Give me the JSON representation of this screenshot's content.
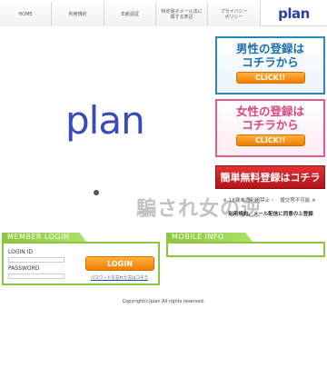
{
  "nav": {
    "items": [
      "HOME",
      "利用規約",
      "年齢認証",
      "特定電子メール法に\n関する表記",
      "プライバシー\nポリシー"
    ],
    "logo": "plan"
  },
  "hero": {
    "logo": "plan"
  },
  "banners": {
    "male_title": "男性の登録は\nコチラから",
    "male_button": "CLICK!!",
    "female_title": "女性の登録は\nコチラから",
    "female_button": "CLICK!!",
    "free_register": "簡単無料登録はコチラ",
    "age_note": "※ 18歳未満利用禁止・　援交等不可能 ※",
    "watermark": "騙され女の逆",
    "terms_note": "利用規約、メール配信に同意の上登録"
  },
  "login": {
    "heading": "MEMBER LOGIN",
    "id_label": "LOGIN ID",
    "password_label": "PASSWORD",
    "id_value": "",
    "password_value": "",
    "button": "LOGIN",
    "forgot": "パスワードを忘れた方はコチラ"
  },
  "mobile": {
    "heading": "MOBILE INFO"
  },
  "footer": {
    "copyright": "Copyright(c)plan All rights reserved."
  },
  "colors": {
    "accent_green": "#8cc63f",
    "brand_blue": "#3a4bb8",
    "button_orange": "#f07d00",
    "register_red": "#c8191f"
  }
}
